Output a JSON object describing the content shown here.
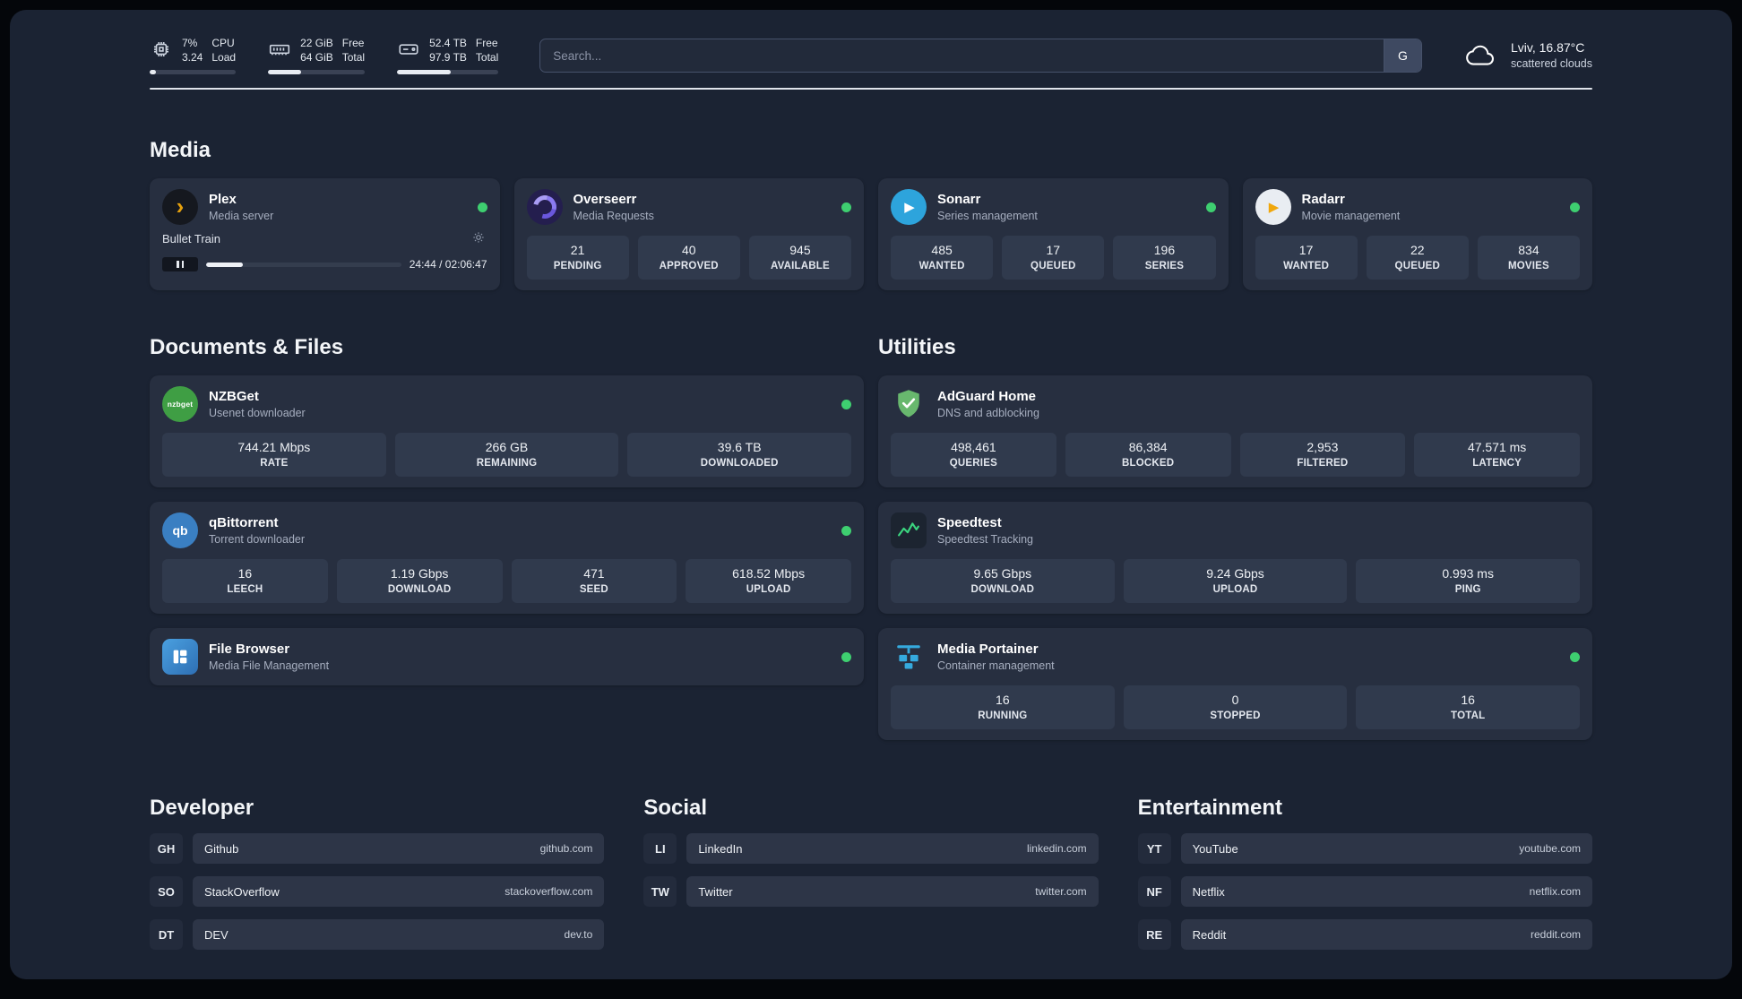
{
  "topbar": {
    "monitors": [
      {
        "id": "cpu",
        "value_top": "7%",
        "value_bottom": "3.24",
        "label_top": "CPU",
        "label_bottom": "Load",
        "percent": 7
      },
      {
        "id": "ram",
        "value_top": "22 GiB",
        "value_bottom": "64 GiB",
        "label_top": "Free",
        "label_bottom": "Total",
        "percent": 34
      },
      {
        "id": "disk",
        "value_top": "52.4 TB",
        "value_bottom": "97.9 TB",
        "label_top": "Free",
        "label_bottom": "Total",
        "percent": 53
      }
    ],
    "search": {
      "placeholder": "Search...",
      "engine_label": "G"
    },
    "weather": {
      "location": "Lviv, 16.87°C",
      "condition": "scattered clouds"
    }
  },
  "icons": {
    "plex_glyph": "›",
    "sonarr_glyph": "▶",
    "radarr_glyph": "▶",
    "nzbget_label": "nzbget",
    "qbittorrent_label": "qb"
  },
  "sections": {
    "media": {
      "title": "Media",
      "apps": [
        {
          "name": "Plex",
          "subtitle": "Media server",
          "player": {
            "track": "Bullet Train",
            "time": "24:44 / 02:06:47",
            "progress": 19
          }
        },
        {
          "name": "Overseerr",
          "subtitle": "Media Requests",
          "stats": [
            {
              "value": "21",
              "label": "PENDING"
            },
            {
              "value": "40",
              "label": "APPROVED"
            },
            {
              "value": "945",
              "label": "AVAILABLE"
            }
          ]
        },
        {
          "name": "Sonarr",
          "subtitle": "Series management",
          "stats": [
            {
              "value": "485",
              "label": "WANTED"
            },
            {
              "value": "17",
              "label": "QUEUED"
            },
            {
              "value": "196",
              "label": "SERIES"
            }
          ]
        },
        {
          "name": "Radarr",
          "subtitle": "Movie management",
          "stats": [
            {
              "value": "17",
              "label": "WANTED"
            },
            {
              "value": "22",
              "label": "QUEUED"
            },
            {
              "value": "834",
              "label": "MOVIES"
            }
          ]
        }
      ]
    },
    "documents": {
      "title": "Documents & Files",
      "apps": [
        {
          "name": "NZBGet",
          "subtitle": "Usenet downloader",
          "stats": [
            {
              "value": "744.21 Mbps",
              "label": "RATE"
            },
            {
              "value": "266 GB",
              "label": "REMAINING"
            },
            {
              "value": "39.6 TB",
              "label": "DOWNLOADED"
            }
          ]
        },
        {
          "name": "qBittorrent",
          "subtitle": "Torrent downloader",
          "stats": [
            {
              "value": "16",
              "label": "LEECH"
            },
            {
              "value": "1.19 Gbps",
              "label": "DOWNLOAD"
            },
            {
              "value": "471",
              "label": "SEED"
            },
            {
              "value": "618.52 Mbps",
              "label": "UPLOAD"
            }
          ]
        },
        {
          "name": "File Browser",
          "subtitle": "Media File Management"
        }
      ]
    },
    "utilities": {
      "title": "Utilities",
      "apps": [
        {
          "name": "AdGuard Home",
          "subtitle": "DNS and adblocking",
          "stats": [
            {
              "value": "498,461",
              "label": "QUERIES"
            },
            {
              "value": "86,384",
              "label": "BLOCKED"
            },
            {
              "value": "2,953",
              "label": "FILTERED"
            },
            {
              "value": "47.571 ms",
              "label": "LATENCY"
            }
          ]
        },
        {
          "name": "Speedtest",
          "subtitle": "Speedtest Tracking",
          "stats": [
            {
              "value": "9.65 Gbps",
              "label": "DOWNLOAD"
            },
            {
              "value": "9.24 Gbps",
              "label": "UPLOAD"
            },
            {
              "value": "0.993 ms",
              "label": "PING"
            }
          ]
        },
        {
          "name": "Media Portainer",
          "subtitle": "Container management",
          "stats": [
            {
              "value": "16",
              "label": "RUNNING"
            },
            {
              "value": "0",
              "label": "STOPPED"
            },
            {
              "value": "16",
              "label": "TOTAL"
            }
          ]
        }
      ]
    }
  },
  "bookmarks": [
    {
      "title": "Developer",
      "items": [
        {
          "abbr": "GH",
          "name": "Github",
          "url": "github.com"
        },
        {
          "abbr": "SO",
          "name": "StackOverflow",
          "url": "stackoverflow.com"
        },
        {
          "abbr": "DT",
          "name": "DEV",
          "url": "dev.to"
        }
      ]
    },
    {
      "title": "Social",
      "items": [
        {
          "abbr": "LI",
          "name": "LinkedIn",
          "url": "linkedin.com"
        },
        {
          "abbr": "TW",
          "name": "Twitter",
          "url": "twitter.com"
        }
      ]
    },
    {
      "title": "Entertainment",
      "items": [
        {
          "abbr": "YT",
          "name": "YouTube",
          "url": "youtube.com"
        },
        {
          "abbr": "NF",
          "name": "Netflix",
          "url": "netflix.com"
        },
        {
          "abbr": "RE",
          "name": "Reddit",
          "url": "reddit.com"
        }
      ]
    }
  ],
  "colors": {
    "status_online": "#3ecf70",
    "plex_accent": "#e5a00d",
    "background": "#1b2333",
    "card": "#272f40"
  }
}
